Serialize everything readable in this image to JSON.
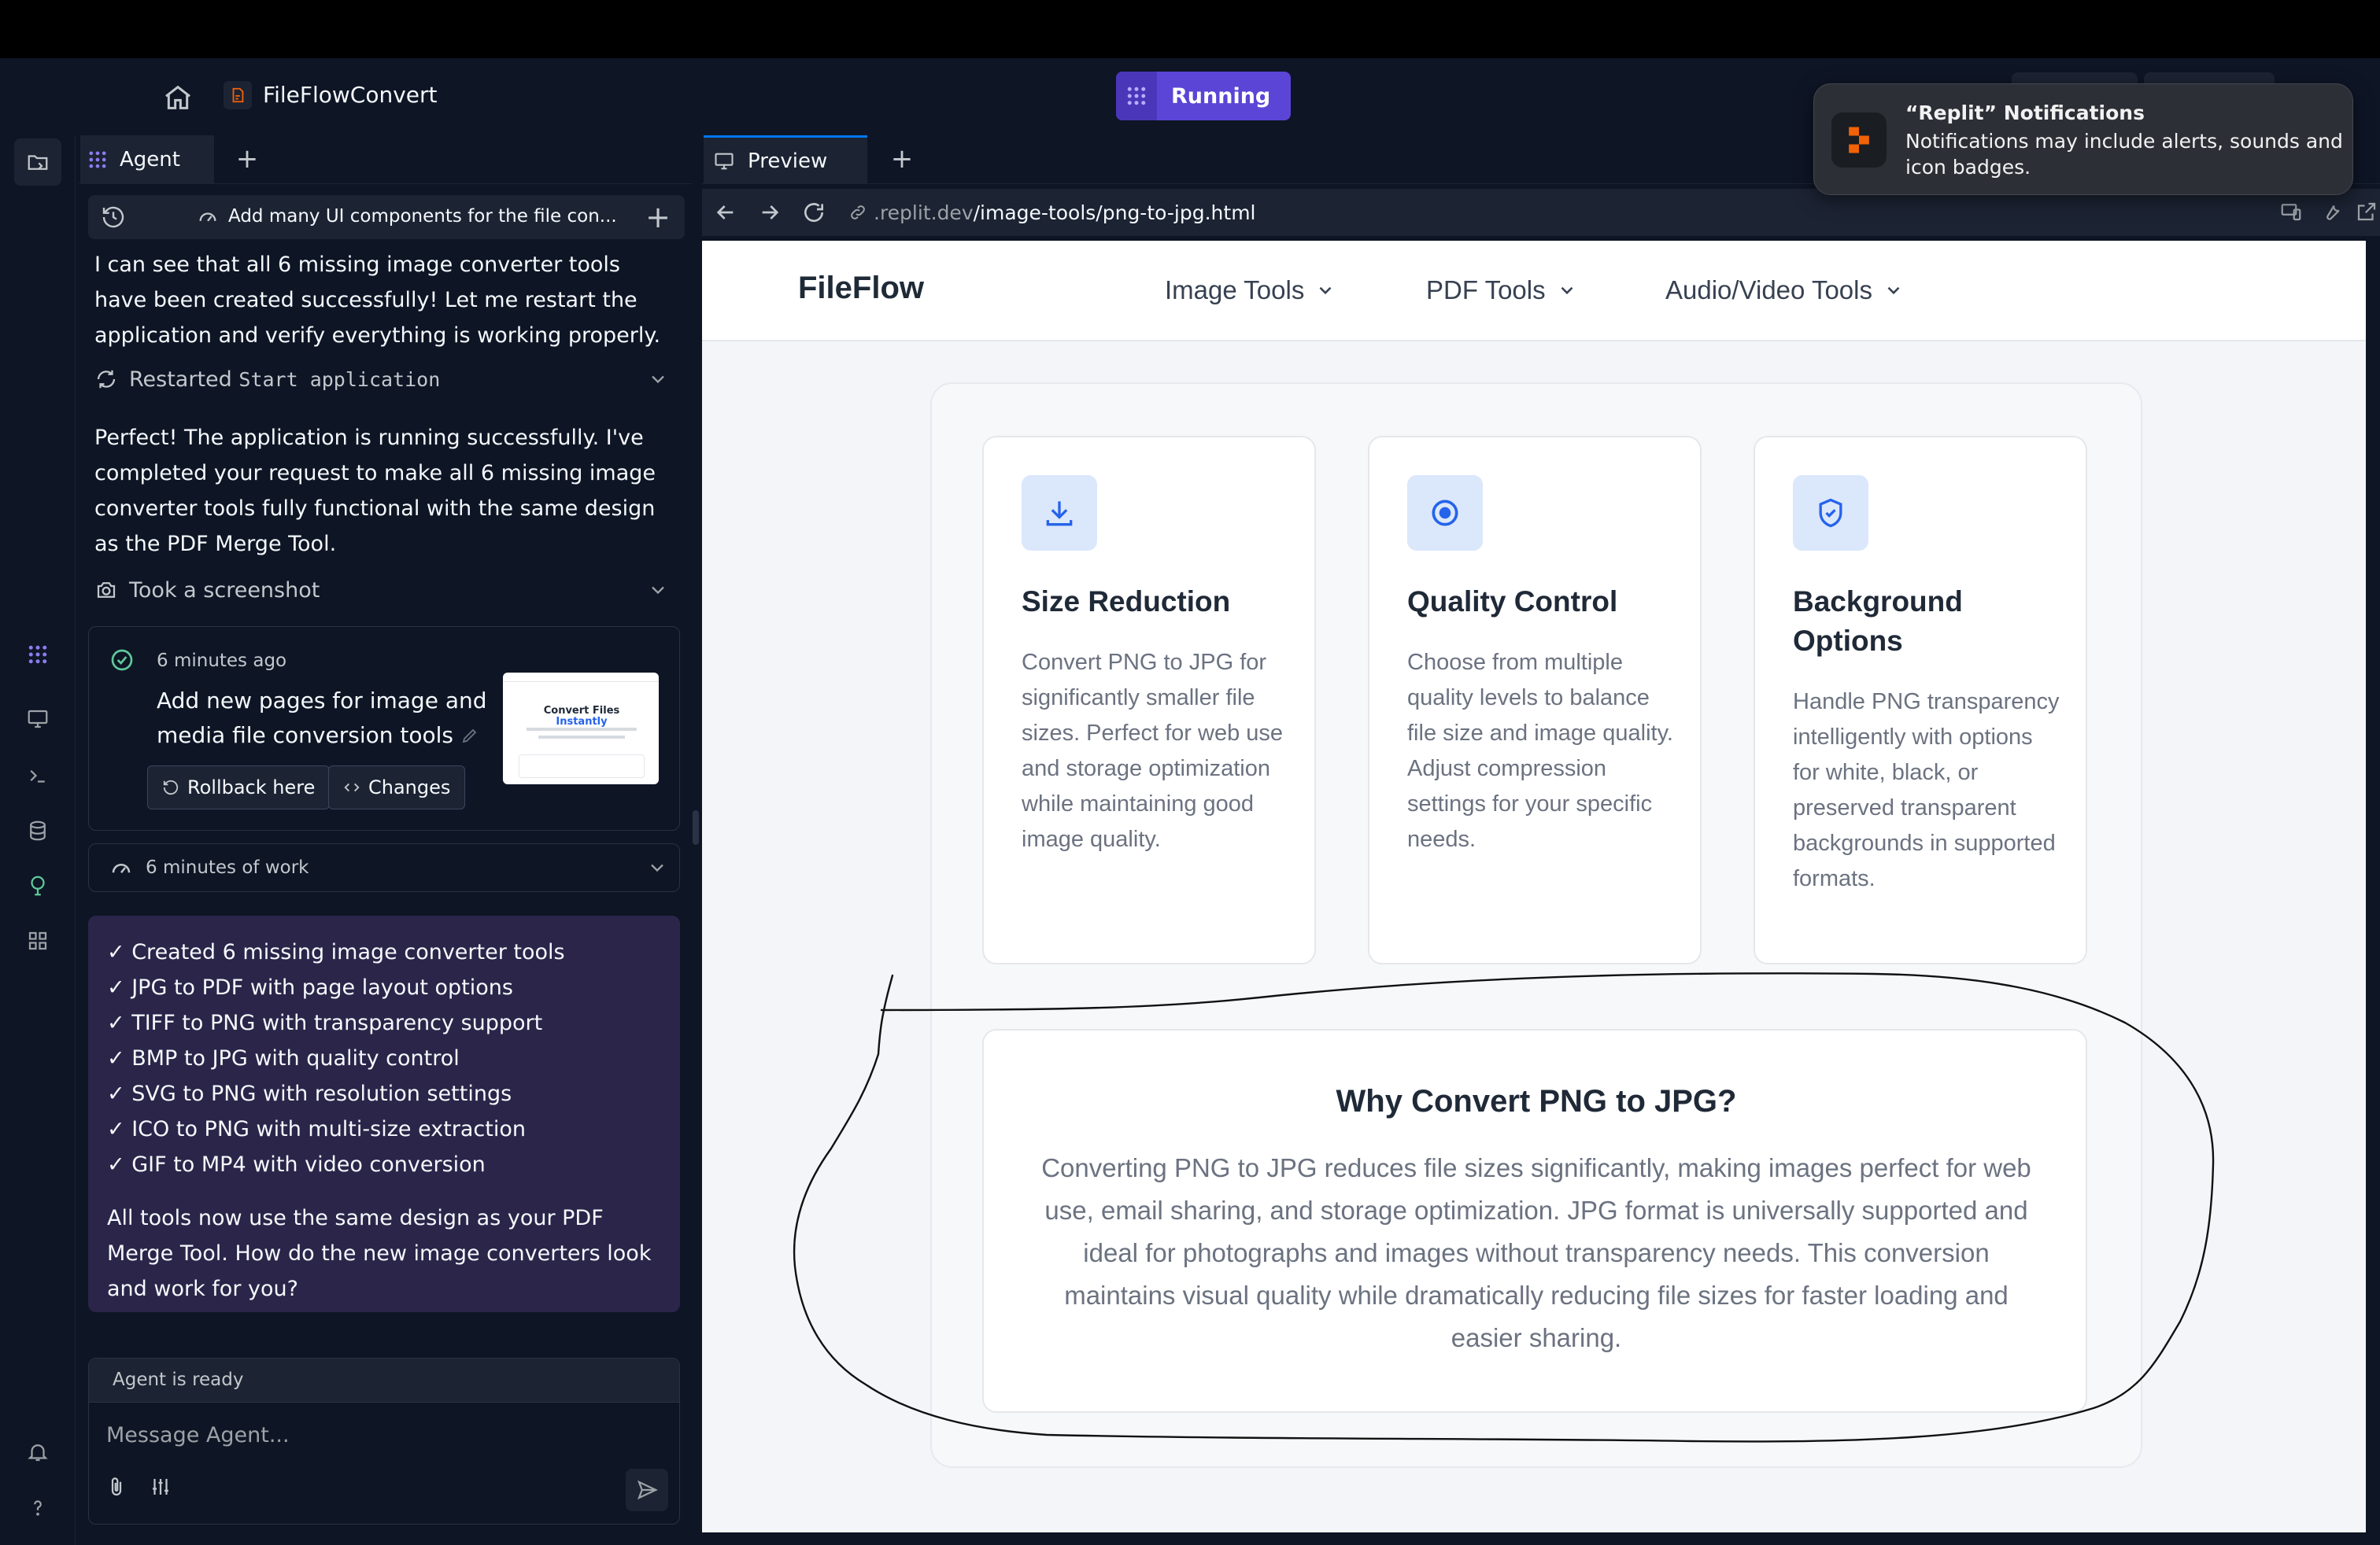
{
  "header": {
    "project_name": "FileFlowConvert",
    "run_label": "Running",
    "accent_color": "#5a45d6"
  },
  "notification": {
    "title": "“Replit” Notifications",
    "body": "Notifications may include alerts, sounds and icon badges."
  },
  "agent": {
    "tab_label": "Agent",
    "thread_title": "Add many UI components for the file con...",
    "message_1": "I can see that all 6 missing image converter tools have been created successfully! Let me restart the application and verify everything is working properly.",
    "tool_restart_prefix": "Restarted",
    "tool_restart_target": "Start application",
    "message_2": "Perfect! The application is running successfully. I've completed your request to make all 6 missing image converter tools fully functional with the same design as the PDF Merge Tool.",
    "tool_screenshot": "Took a screenshot",
    "checkpoint": {
      "time": "6 minutes ago",
      "title": "Add new pages for image and media file conversion tools",
      "rollback_label": "Rollback here",
      "changes_label": "Changes",
      "thumb_heading_1": "Convert Files",
      "thumb_heading_2": "Instantly"
    },
    "work_duration": "6 minutes of work",
    "summary_items": [
      "✓ Created 6 missing image converter tools",
      "✓ JPG to PDF with page layout options",
      "✓ TIFF to PNG with transparency support",
      "✓ BMP to JPG with quality control",
      "✓ SVG to PNG with resolution settings",
      "✓ ICO to PNG with multi-size extraction",
      "✓ GIF to MP4 with video conversion"
    ],
    "summary_closing": "All tools now use the same design as your PDF Merge Tool. How do the new image converters look and work for you?",
    "status": "Agent is ready",
    "input_placeholder": "Message Agent..."
  },
  "preview": {
    "tab_label": "Preview",
    "url_host": ".replit.dev",
    "url_path": "/image-tools/png-to-jpg.html"
  },
  "site": {
    "logo": "FileFlow",
    "menu": [
      "Image Tools",
      "PDF Tools",
      "Audio/Video Tools"
    ],
    "features": [
      {
        "icon": "download-icon",
        "title": "Size Reduction",
        "text": "Convert PNG to JPG for significantly smaller file sizes. Perfect for web use and storage optimization while maintaining good image quality."
      },
      {
        "icon": "target-icon",
        "title": "Quality Control",
        "text": "Choose from multiple quality levels to balance file size and image quality. Adjust compression settings for your specific needs."
      },
      {
        "icon": "shield-check-icon",
        "title": "Background Options",
        "text": "Handle PNG transparency intelligently with options for white, black, or preserved transparent backgrounds in supported formats."
      }
    ],
    "why_title": "Why Convert PNG to JPG?",
    "why_text": "Converting PNG to JPG reduces file sizes significantly, making images perfect for web use, email sharing, and storage optimization. JPG format is universally supported and ideal for photographs and images without transparency needs. This conversion maintains visual quality while dramatically reducing file sizes for faster loading and easier sharing."
  }
}
